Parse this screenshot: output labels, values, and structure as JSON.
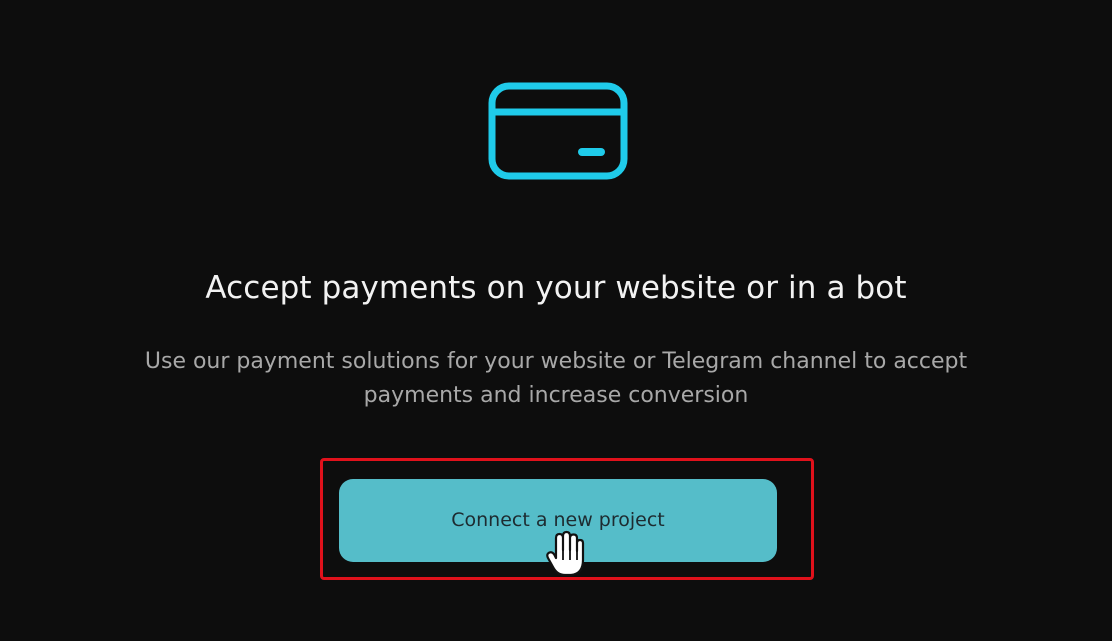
{
  "hero": {
    "icon": "credit-card-icon",
    "icon_color": "#1fcbea",
    "title": "Accept payments on your website or in a bot",
    "subtitle": "Use our payment solutions for your website or Telegram channel to accept payments and increase conversion"
  },
  "cta": {
    "label": "Connect a new project",
    "background": "#55bdc9",
    "highlight_color": "#e0111b"
  },
  "cursor": {
    "icon": "hand-pointer-icon"
  }
}
